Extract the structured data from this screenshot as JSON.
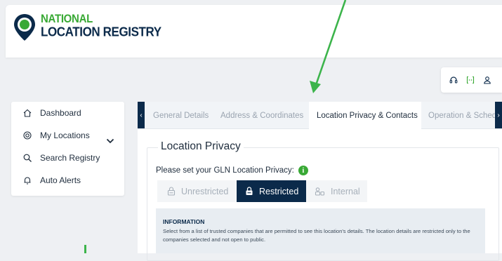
{
  "brand": {
    "line1": "NATIONAL",
    "line2": "LOCATION REGISTRY",
    "colors": {
      "green": "#39a935",
      "navy": "#0b2a4a"
    }
  },
  "utilities": {
    "icons": [
      "headset-icon",
      "brackets-icon",
      "user-icon"
    ]
  },
  "sidebar": {
    "items": [
      {
        "label": "Dashboard",
        "icon": "home-icon"
      },
      {
        "label": "My Locations",
        "icon": "location-icon",
        "expandable": true
      },
      {
        "label": "Search Registry",
        "icon": "search-icon"
      },
      {
        "label": "Auto Alerts",
        "icon": "bell-icon"
      }
    ]
  },
  "tabs": [
    {
      "label": "General Details"
    },
    {
      "label": "Address & Coordinates"
    },
    {
      "label": "Location Privacy & Contacts",
      "active": true
    },
    {
      "label": "Operation & Schedule"
    }
  ],
  "privacy": {
    "section_title": "Location Privacy",
    "question": "Please set your GLN Location Privacy:",
    "info_marker": "i",
    "options": [
      {
        "label": "Unrestricted",
        "icon": "lock-open-icon"
      },
      {
        "label": "Restricted",
        "icon": "lock-icon",
        "selected": true
      },
      {
        "label": "Internal",
        "icon": "users-icon"
      }
    ],
    "info_title": "INFORMATION",
    "info_text": "Select from a list of trusted companies that are permitted to see this location's details. The location details are restricted only to the companies selected and not open to public."
  }
}
